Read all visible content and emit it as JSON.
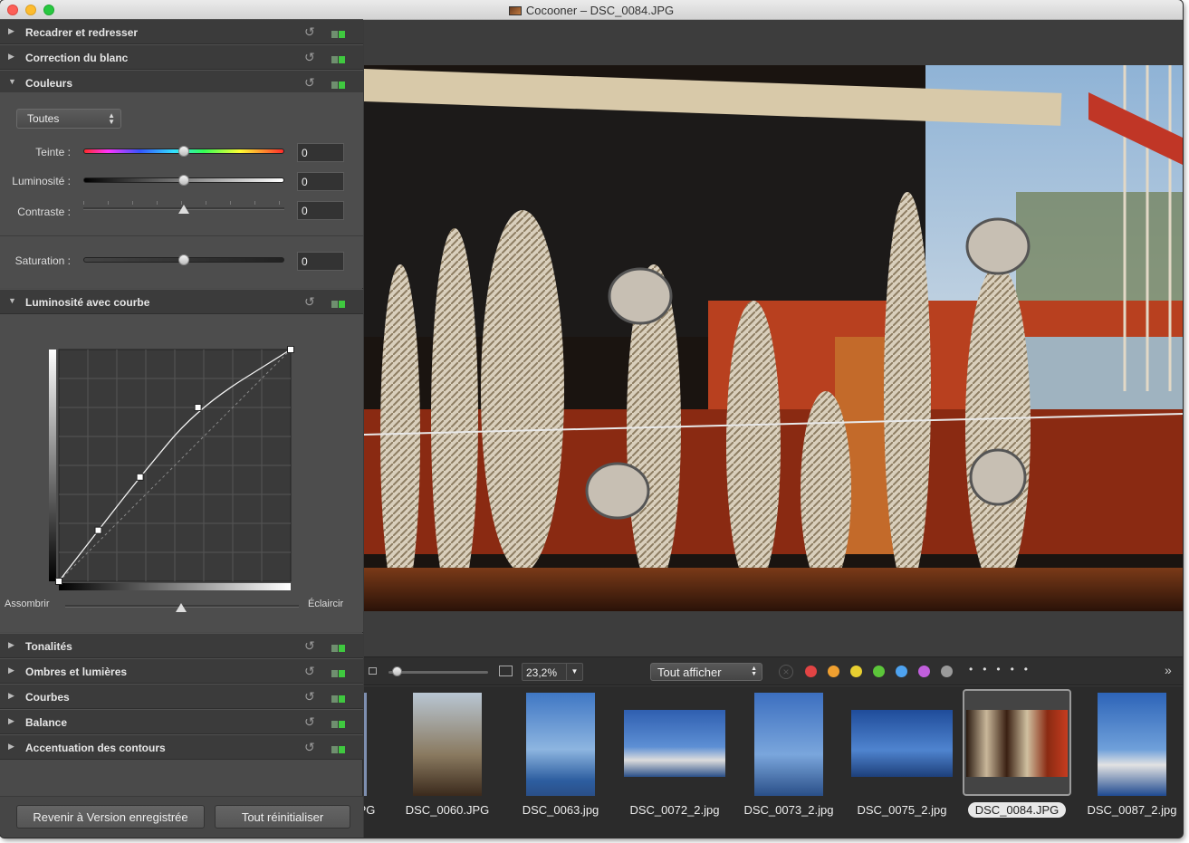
{
  "window": {
    "title": "Cocooner – DSC_0084.JPG"
  },
  "sections_top": [
    {
      "label": "Recadrer et redresser",
      "expanded": false
    },
    {
      "label": "Correction du blanc",
      "expanded": false
    },
    {
      "label": "Couleurs",
      "expanded": true
    }
  ],
  "colors": {
    "channel_select": "Toutes",
    "teinte": {
      "label": "Teinte :",
      "value": "0",
      "level": 0.5
    },
    "luminosite": {
      "label": "Luminosité :",
      "value": "0",
      "level": 0.5
    },
    "contraste": {
      "label": "Contraste :",
      "value": "0",
      "level": 0.5
    },
    "saturation": {
      "label": "Saturation :",
      "value": "0",
      "level": 0.5
    }
  },
  "curve_section": {
    "label": "Luminosité avec courbe",
    "darken_label": "Assombrir",
    "lighten_label": "Éclaircir",
    "bias_level": 0.5,
    "points": [
      [
        0,
        0
      ],
      [
        0.17,
        0.22
      ],
      [
        0.35,
        0.45
      ],
      [
        0.6,
        0.75
      ],
      [
        1,
        1
      ]
    ]
  },
  "sections_bottom": [
    {
      "label": "Tonalités",
      "expanded": false
    },
    {
      "label": "Ombres et lumières",
      "expanded": false
    },
    {
      "label": "Courbes",
      "expanded": false
    },
    {
      "label": "Balance",
      "expanded": false
    },
    {
      "label": "Accentuation des contours",
      "expanded": false
    }
  ],
  "buttons": {
    "revert": "Revenir à Version enregistrée",
    "reset_all": "Tout réinitialiser"
  },
  "toolbar": {
    "zoom_value": "23,2%",
    "zoom_level": 0.05,
    "filter_select": "Tout afficher",
    "color_labels": [
      "#e24444",
      "#f0a030",
      "#e8cf30",
      "#5cc63a",
      "#4ea3f0",
      "#c15fdc",
      "#9a9a9a"
    ],
    "more_icon": "chevron-double-right-icon"
  },
  "filmstrip": [
    {
      "name": "PG",
      "selected": false
    },
    {
      "name": "DSC_0060.JPG",
      "selected": false
    },
    {
      "name": "DSC_0063.jpg",
      "selected": false
    },
    {
      "name": "DSC_0072_2.jpg",
      "selected": false
    },
    {
      "name": "DSC_0073_2.jpg",
      "selected": false
    },
    {
      "name": "DSC_0075_2.jpg",
      "selected": false
    },
    {
      "name": "DSC_0084.JPG",
      "selected": true
    },
    {
      "name": "DSC_0087_2.jpg",
      "selected": false
    }
  ]
}
